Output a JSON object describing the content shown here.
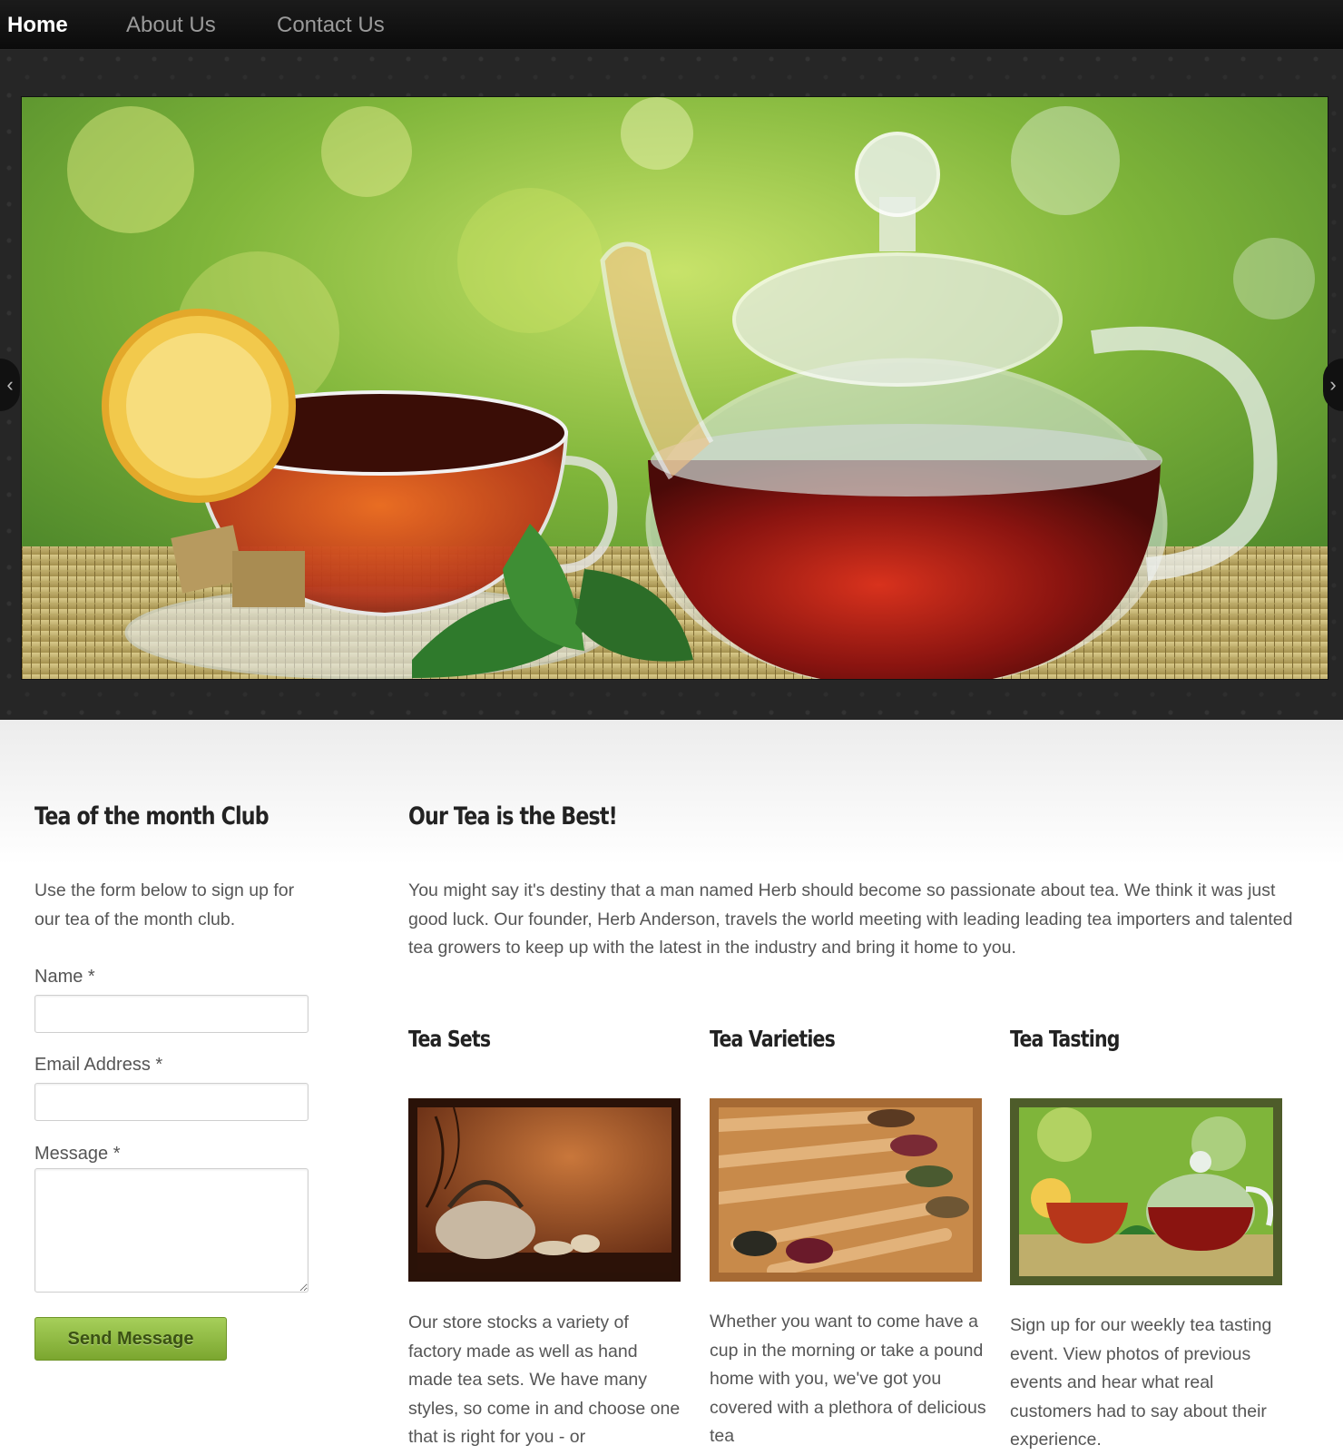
{
  "nav": {
    "items": [
      {
        "label": "Home",
        "active": true
      },
      {
        "label": "About Us",
        "active": false
      },
      {
        "label": "Contact Us",
        "active": false
      }
    ]
  },
  "slider": {
    "prev_arrow": "‹",
    "next_arrow": "›",
    "image": "teapot-and-tea-cup-on-bamboo-mat"
  },
  "club": {
    "title": "Tea of the month Club",
    "intro": "Use the form below to sign up for our tea of the month club.",
    "name_label": "Name *",
    "email_label": "Email Address *",
    "message_label": "Message *",
    "name_value": "",
    "email_value": "",
    "message_value": "",
    "submit_label": "Send Message"
  },
  "about": {
    "title": "Our Tea is the Best!",
    "body": "You might say it's destiny that a man named Herb should become so passionate about tea. We think it was just good luck. Our founder, Herb Anderson, travels the world meeting with leading leading tea importers and talented tea growers to keep up with the latest in the industry and bring it home to you."
  },
  "features": [
    {
      "title": "Tea Sets",
      "image": "iron-teapot-and-cups",
      "text": "Our store stocks a variety of factory made as well as hand made tea sets. We have many styles, so come in and choose one that is right for you - or"
    },
    {
      "title": "Tea Varieties",
      "image": "wooden-spoons-with-tea-leaves",
      "text": "Whether you want to come have a cup in the morning or take a pound home with you, we've got you covered with a plethora of delicious tea"
    },
    {
      "title": "Tea Tasting",
      "image": "teapot-and-cup-on-mat",
      "text": "Sign up for our weekly tea tasting event. View photos of previous events and hear what real customers had to say about their experience."
    }
  ],
  "colors": {
    "nav_bg": "#111111",
    "button_green": "#8cb83e",
    "heading": "#222222",
    "body_text": "#555555"
  }
}
